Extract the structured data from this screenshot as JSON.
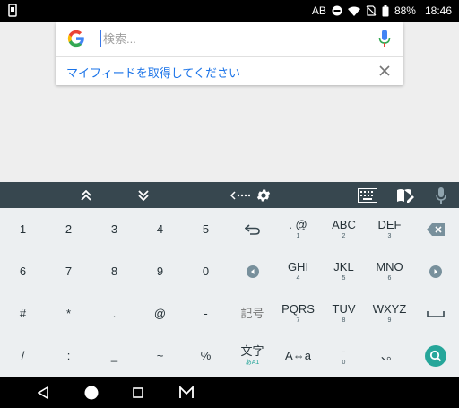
{
  "status_bar": {
    "carrier": "AB",
    "battery": "88%",
    "time": "18:46",
    "icons": [
      "phone-icon",
      "dnd-icon",
      "wifi-icon",
      "no-sim-icon",
      "battery-icon"
    ]
  },
  "search": {
    "placeholder": "検索...",
    "feed_prompt": "マイフィードを取得してください"
  },
  "keyboard": {
    "toolbar_icons": [
      "chevron-double-up-icon",
      "chevron-double-down-icon",
      "keyboard-arrow-icon",
      "gear-icon",
      "keyboard-grid-icon",
      "dictionary-edit-icon",
      "mic-icon"
    ],
    "rows": [
      [
        {
          "main": "1"
        },
        {
          "main": "2"
        },
        {
          "main": "3"
        },
        {
          "main": "4"
        },
        {
          "main": "5"
        },
        {
          "icon": "undo-icon"
        },
        {
          "main": ". @",
          "sub": "1"
        },
        {
          "main": "ABC",
          "sub": "2"
        },
        {
          "main": "DEF",
          "sub": "3"
        },
        {
          "icon": "backspace-icon"
        }
      ],
      [
        {
          "main": "6"
        },
        {
          "main": "7"
        },
        {
          "main": "8"
        },
        {
          "main": "9"
        },
        {
          "main": "0"
        },
        {
          "icon": "left-arrow-icon"
        },
        {
          "main": "GHI",
          "sub": "4"
        },
        {
          "main": "JKL",
          "sub": "5"
        },
        {
          "main": "MNO",
          "sub": "6"
        },
        {
          "icon": "right-arrow-icon"
        }
      ],
      [
        {
          "main": "#"
        },
        {
          "main": "*"
        },
        {
          "main": "."
        },
        {
          "main": "@"
        },
        {
          "main": "-"
        },
        {
          "main": "記号"
        },
        {
          "main": "PQRS",
          "sub": "7"
        },
        {
          "main": "TUV",
          "sub": "8"
        },
        {
          "main": "WXYZ",
          "sub": "9"
        },
        {
          "icon": "space-icon"
        }
      ],
      [
        {
          "main": "/"
        },
        {
          "main": ":"
        },
        {
          "main": "_"
        },
        {
          "main": "~"
        },
        {
          "main": "%"
        },
        {
          "main": "文字",
          "sub": "あA1"
        },
        {
          "main": "A⇔a"
        },
        {
          "main": "-",
          "sub": "0"
        },
        {
          "main": "、。"
        },
        {
          "icon": "search-icon"
        }
      ]
    ]
  },
  "nav_bar": {
    "icons": [
      "back-icon",
      "home-icon",
      "recents-icon",
      "gmail-icon"
    ]
  },
  "colors": {
    "toolbar": "#37474f",
    "keyboard_bg": "#eceff1",
    "search_key": "#26a69a",
    "link": "#1a73e8"
  }
}
